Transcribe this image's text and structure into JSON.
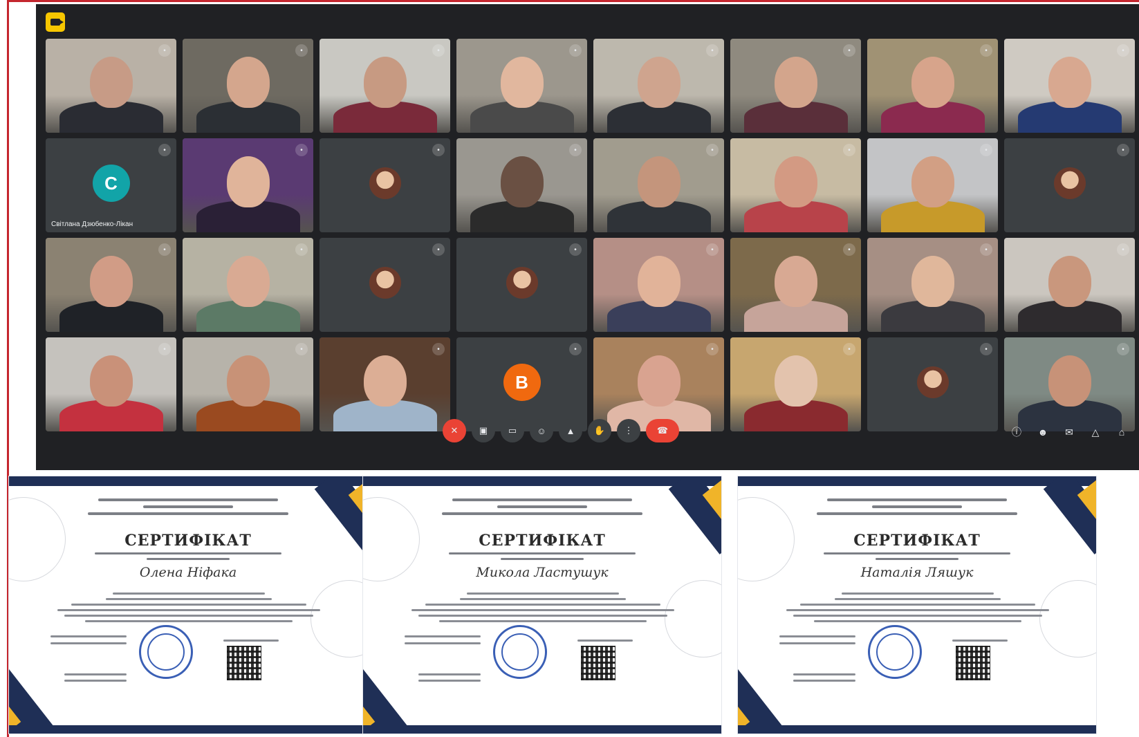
{
  "window": {
    "app_icon": "camera-icon"
  },
  "participants": [
    {
      "name": "",
      "bg": "#b9b1a6",
      "skin": "#c79b86",
      "shirt": "#2a2c33"
    },
    {
      "name": "",
      "bg": "#6e6a61",
      "skin": "#d4a68d",
      "shirt": "#2b2f34"
    },
    {
      "name": "",
      "bg": "#c9c8c2",
      "skin": "#c79a82",
      "shirt": "#7a2a3a"
    },
    {
      "name": "",
      "bg": "#9c978d",
      "skin": "#e1b79e",
      "shirt": "#4a4a4a"
    },
    {
      "name": "",
      "bg": "#bdb8ad",
      "skin": "#cfa48e",
      "shirt": "#2c2f35"
    },
    {
      "name": "",
      "bg": "#8f8a7f",
      "skin": "#d3a58c",
      "shirt": "#5a2f3a"
    },
    {
      "name": "",
      "bg": "#a09274",
      "skin": "#d7a48b",
      "shirt": "#8b2a4f"
    },
    {
      "name": "",
      "bg": "#cfcac2",
      "skin": "#d8a890",
      "shirt": "#253a72"
    },
    {
      "name": "Світлана Дзюбенко-Лікан",
      "avatar_letter": "С",
      "avatar_color": "#12a4a8"
    },
    {
      "name": "",
      "bg": "#5a3a72",
      "skin": "#e0b49a",
      "shirt": "#2a2036"
    },
    {
      "name": "",
      "photo_avatar": true
    },
    {
      "name": "",
      "bg": "#9a9790",
      "skin": "#6a5043",
      "shirt": "#2b2b2b"
    },
    {
      "name": "",
      "bg": "#a19c8e",
      "skin": "#c4957c",
      "shirt": "#2f3338"
    },
    {
      "name": "",
      "bg": "#c7bba3",
      "skin": "#d39a83",
      "shirt": "#b8434a"
    },
    {
      "name": "",
      "bg": "#c3c4c6",
      "skin": "#d29f84",
      "shirt": "#c79a2a"
    },
    {
      "name": "",
      "photo_avatar": true
    },
    {
      "name": "",
      "bg": "#8b8272",
      "skin": "#d19c86",
      "shirt": "#1f2227"
    },
    {
      "name": "",
      "bg": "#b6b2a3",
      "skin": "#d9aa93",
      "shirt": "#5c7a66"
    },
    {
      "name": "",
      "photo_avatar": true
    },
    {
      "name": "",
      "photo_avatar": true
    },
    {
      "name": "",
      "bg": "#b58f86",
      "skin": "#e1b399",
      "shirt": "#3a3f5a"
    },
    {
      "name": "",
      "bg": "#7d6a4b",
      "skin": "#d8a993",
      "shirt": "#c6a49a"
    },
    {
      "name": "",
      "bg": "#a68f84",
      "skin": "#e0b79b",
      "shirt": "#3b3a3f"
    },
    {
      "name": "",
      "bg": "#cbc6bf",
      "skin": "#c9977d",
      "shirt": "#2e2b2e"
    },
    {
      "name": "",
      "bg": "#c5c2bd",
      "skin": "#c99179",
      "shirt": "#c4313f"
    },
    {
      "name": "",
      "bg": "#b7b3aa",
      "skin": "#c89277",
      "shirt": "#9a4a20"
    },
    {
      "name": "",
      "bg": "#5a3f2f",
      "skin": "#dcae95",
      "shirt": "#9fb4c9"
    },
    {
      "name": "",
      "avatar_letter": "В",
      "avatar_color": "#f0690f"
    },
    {
      "name": "",
      "bg": "#a9825d",
      "skin": "#d9a390",
      "shirt": "#e0b7a6"
    },
    {
      "name": "",
      "bg": "#c7a66f",
      "skin": "#e3c3ad",
      "shirt": "#8a2a2f"
    },
    {
      "name": "",
      "photo_avatar": true
    },
    {
      "name": "",
      "bg": "#7f8a84",
      "skin": "#c79278",
      "shirt": "#2c3340"
    }
  ],
  "toolbar": {
    "time": "",
    "meeting_code": "",
    "controls": [
      "mic-off-icon",
      "camera-icon",
      "captions-icon",
      "emoji-icon",
      "present-icon",
      "raise-hand-icon",
      "more-icon"
    ],
    "leave_icon": "phone-hangup-icon",
    "right_icons": [
      "info-icon",
      "people-icon",
      "chat-icon",
      "activities-icon",
      "lock-icon"
    ]
  },
  "certificates": [
    {
      "title": "СЕРТИФІКАТ",
      "recipient": "Олена Ніфака"
    },
    {
      "title": "СЕРТИФІКАТ",
      "recipient": "Микола Ластушук"
    },
    {
      "title": "СЕРТИФІКАТ",
      "recipient": "Наталія Ляшук"
    }
  ],
  "colors": {
    "meet_bg": "#202124",
    "tile_bg": "#3c4043",
    "cert_navy": "#1f2f56",
    "cert_gold": "#f0b429",
    "seal_blue": "#3a5fb5",
    "leave_red": "#ea4335"
  }
}
